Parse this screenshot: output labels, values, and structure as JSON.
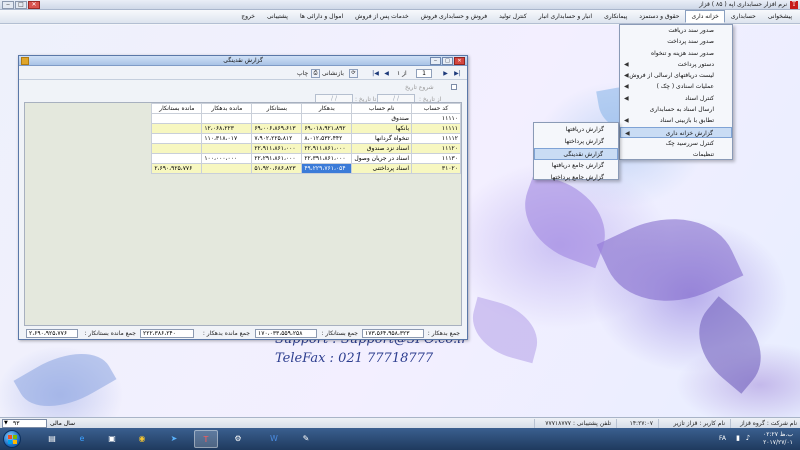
{
  "window": {
    "title": "نرم افزار حسابداری اپه ( ۸۵ ) قزاز",
    "minimize": "‒",
    "maximize": "□",
    "close": "✕"
  },
  "menu": [
    "پیشخوانی",
    "حسابداری",
    "خزانه داری",
    "حقوق و دستمزد",
    "پیمانکاری",
    "انبار و حسابداری انبار",
    "کنترل تولید",
    "فروش و حسابداری فروش",
    "خدمات پس از فروش",
    "اموال و دارائی ها",
    "پشتیبانی",
    "خروج"
  ],
  "dropdown": {
    "items": [
      {
        "label": "صدور سند دریافت",
        "sub": false
      },
      {
        "label": "صدور سند پرداخت",
        "sub": false
      },
      {
        "label": "صدور سند هزینه و تنخواه",
        "sub": false
      },
      {
        "label": "دستور پرداخت",
        "sub": true
      },
      {
        "label": "لیست دریافتهای ارسالی از فروش",
        "sub": true
      },
      {
        "label": "عملیات اسنادی ( چک )",
        "sub": true
      },
      {
        "label": "کنترل اسناد",
        "sub": true
      },
      {
        "label": "ارسال اسناد به حسابداری",
        "sub": false
      },
      {
        "label": "تطابق با بازبینی اسناد",
        "sub": true
      },
      {
        "label": "گزارش خزانه داری",
        "sub": true,
        "highlight": true
      },
      {
        "label": "کنترل سررسید چک",
        "sub": false
      },
      {
        "label": "تنظیمات",
        "sub": false
      }
    ]
  },
  "submenu": {
    "items": [
      {
        "label": "گزارش دریافتها"
      },
      {
        "label": "گزارش پرداختها"
      },
      {
        "label": "گزارش نقدینگی",
        "highlight": true
      },
      {
        "label": "گزارش جامع دریافتها"
      },
      {
        "label": "گزارش جامع پرداختها"
      }
    ]
  },
  "report": {
    "title": "گزارش نقدینگی",
    "page_current": "1",
    "page_of": "از ۱",
    "refresh_label": "بازنشانی",
    "print_label": "چاپ",
    "first": "|◀",
    "prev": "◀",
    "next": "▶",
    "last": "▶|",
    "date_filter_label": "شروع تاریخ",
    "from_date_label": "از تاریخ :",
    "to_date_label": "تا تاریخ :",
    "from_date": "/    /",
    "to_date": "/    /",
    "columns": [
      "کد حساب",
      "نام حساب",
      "بدهکار",
      "بستانکار",
      "مانده بدهکار",
      "مانده بستانکار"
    ],
    "rows": [
      {
        "code": "۱۱۱۱۰",
        "name": "صندوق",
        "debit": "",
        "credit": "",
        "rem_debit": "",
        "rem_credit": ""
      },
      {
        "code": "۱۱۱۱۱",
        "name": "بانکها",
        "debit": "۶۹،۰۱۸،۹۲۱،۸۹۲",
        "credit": "۶۹،۰۰۶،۸۶۹،۶۱۳",
        "rem_debit": "۱۲،۰۶۸،۲۲۳",
        "rem_credit": ""
      },
      {
        "code": "۱۱۱۱۲",
        "name": "تنخواه گردانها",
        "debit": "۸،۰۱۲،۵۳۲،۴۴۲",
        "credit": "۷،۹۰۲،۲۲۵،۸۱۲",
        "rem_debit": "۱۱۰،۳۱۸،۰۱۷",
        "rem_credit": ""
      },
      {
        "code": "۱۱۱۲۰",
        "name": "اسناد نزد صندوق",
        "debit": "۲۲،۹۱۱،۸۶۱،۰۰۰",
        "credit": "۲۲،۹۱۱،۸۶۱،۰۰۰",
        "rem_debit": "",
        "rem_credit": ""
      },
      {
        "code": "۱۱۱۳۰",
        "name": "اسناد در جریان وصول",
        "debit": "۲۲،۳۹۱،۸۶۱،۰۰۰",
        "credit": "۲۲،۲۹۱،۸۶۱،۰۰۰",
        "rem_debit": "۱۰۰،۰۰۰،۰۰۰",
        "rem_credit": ""
      },
      {
        "code": "۳۱۰۲۰",
        "name": "اسناد پرداختنی",
        "debit": "۴۹،۲۲۹،۷۶۱،۰۵۴",
        "credit": "۵۱،۹۲۰،۶۸۶،۸۲۳",
        "rem_debit": "",
        "rem_credit": "۲،۶۹۰،۹۲۵،۷۷۶",
        "selected": "debit"
      }
    ],
    "totals": {
      "debit_label": "جمع بدهکار :",
      "debit": "۱۷۳،۵۶۴،۹۵۸،۳۲۳",
      "credit_label": "جمع بستانکار :",
      "credit": "۱۷۰،۰۳۳،۵۵۹،۲۵۸",
      "rem_debit_label": "جمع مانده بدهکار :",
      "rem_debit": "۲۲۲،۳۸۶،۲۴۰",
      "rem_credit_label": "جمع مانده بستانکار :",
      "rem_credit": "۲،۶۹۰،۹۲۵،۷۷۶"
    }
  },
  "support": {
    "line1": "Support : Support@3PO.co.ir",
    "line2": "TeleFax : 021 77718777"
  },
  "statusbar": {
    "company": "نام شرکت : گروه قزاز",
    "user": "نام کاربر : قزاز تازیر",
    "time": "۱۴:۲۷:۰۷",
    "phone": "تلفن پشتیبانی : ۷۷۷۱۸۷۷۷",
    "year_label": "سال مالی",
    "year_value": "۹۳",
    "year_arrow": "▼"
  },
  "taskbar": {
    "clock_time": "۰۲:۲۷ ب.ظ",
    "clock_date": "۲۰۱۷/۲۷/۰۱",
    "lang": "FA"
  }
}
